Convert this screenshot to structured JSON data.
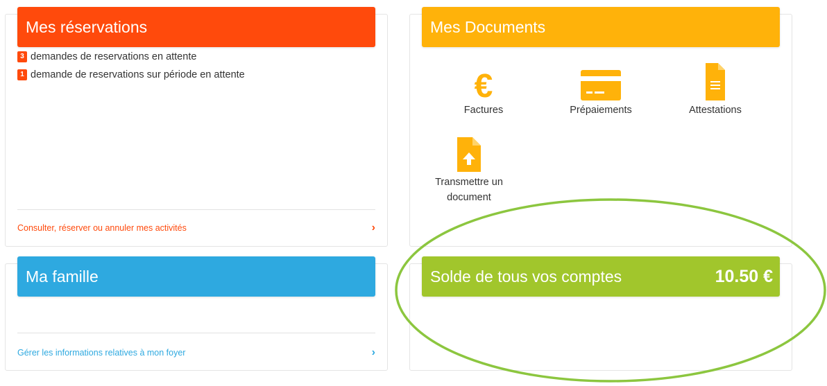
{
  "colors": {
    "reservations": "#ff4a0c",
    "documents": "#ffb20a",
    "famille": "#2ea9e0",
    "solde": "#a1c62c",
    "annotation": "#8cc63f"
  },
  "reservations": {
    "title": "Mes réservations",
    "items": [
      {
        "count": "3",
        "text": "demandes de reservations en attente"
      },
      {
        "count": "1",
        "text": "demande de reservations sur période en attente"
      }
    ],
    "link": "Consulter, réserver ou annuler mes activités",
    "chevron": "›"
  },
  "documents": {
    "title": "Mes Documents",
    "items": [
      {
        "label": "Factures",
        "icon": "euro-icon"
      },
      {
        "label": "Prépaiements",
        "icon": "credit-card-icon"
      },
      {
        "label": "Attestations",
        "icon": "document-icon"
      },
      {
        "label": "Transmettre un document",
        "icon": "upload-document-icon"
      }
    ]
  },
  "famille": {
    "title": "Ma famille",
    "link": "Gérer les informations relatives à mon foyer",
    "chevron": "›"
  },
  "solde": {
    "title": "Solde de tous vos comptes",
    "amount": "10.50 €"
  }
}
